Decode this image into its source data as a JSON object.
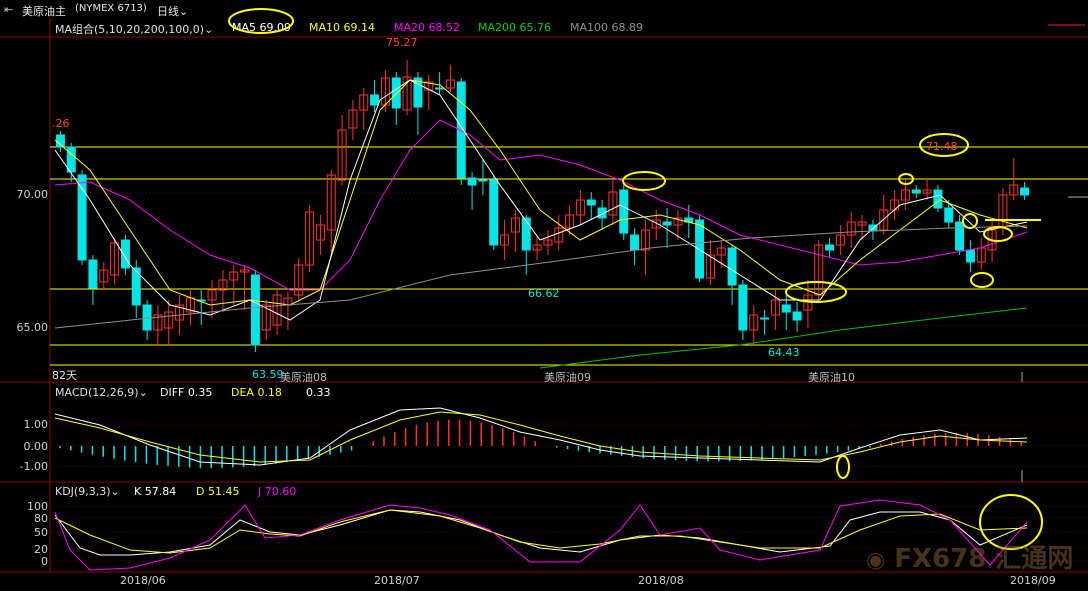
{
  "header": {
    "symbol": "美原油主",
    "contract": "(NYMEX 6713)",
    "period": "日线"
  },
  "ma_legend": {
    "label": "MA组合(5,10,20,200,100,0)",
    "ma5": "MA5 69.09",
    "ma10": "MA10 69.14",
    "ma20": "MA20 68.52",
    "ma200": "MA200 65.76",
    "ma100": "MA100 68.89",
    "colors": {
      "ma5": "#ffffff",
      "ma10": "#ffff00",
      "ma20": "#ff00ff",
      "ma200": "#00c000",
      "ma100": "#909090"
    }
  },
  "price_axis": [
    "70.00",
    "65.00"
  ],
  "price_annotations": {
    "high": "75.27",
    "left_edge": ".26",
    "low1": "63.59",
    "low2": "66.62",
    "low3": "64.43",
    "recent_high": "71.48"
  },
  "contract_labels": {
    "days": "82天",
    "c08": "美原油08",
    "c09": "美原油09",
    "c10": "美原油10"
  },
  "macd_legend": {
    "label": "MACD(12,26,9)",
    "diff": "DIFF 0.35",
    "dea": "DEA 0.18",
    "macd": "0.33"
  },
  "macd_axis": [
    "1.00",
    "0.00",
    "-1.00"
  ],
  "kdj_legend": {
    "label": "KDJ(9,3,3)",
    "k": "K 57.84",
    "d": "D 51.45",
    "j": "J 70.60"
  },
  "kdj_axis": [
    "100",
    "80",
    "50",
    "20",
    "0"
  ],
  "date_axis": [
    "2018/06",
    "2018/07",
    "2018/08",
    "2018/09"
  ],
  "watermark": "FX678 汇通网",
  "colors": {
    "up": "#ff3030",
    "down": "#00e6e6",
    "highlight": "#ffff00"
  }
}
